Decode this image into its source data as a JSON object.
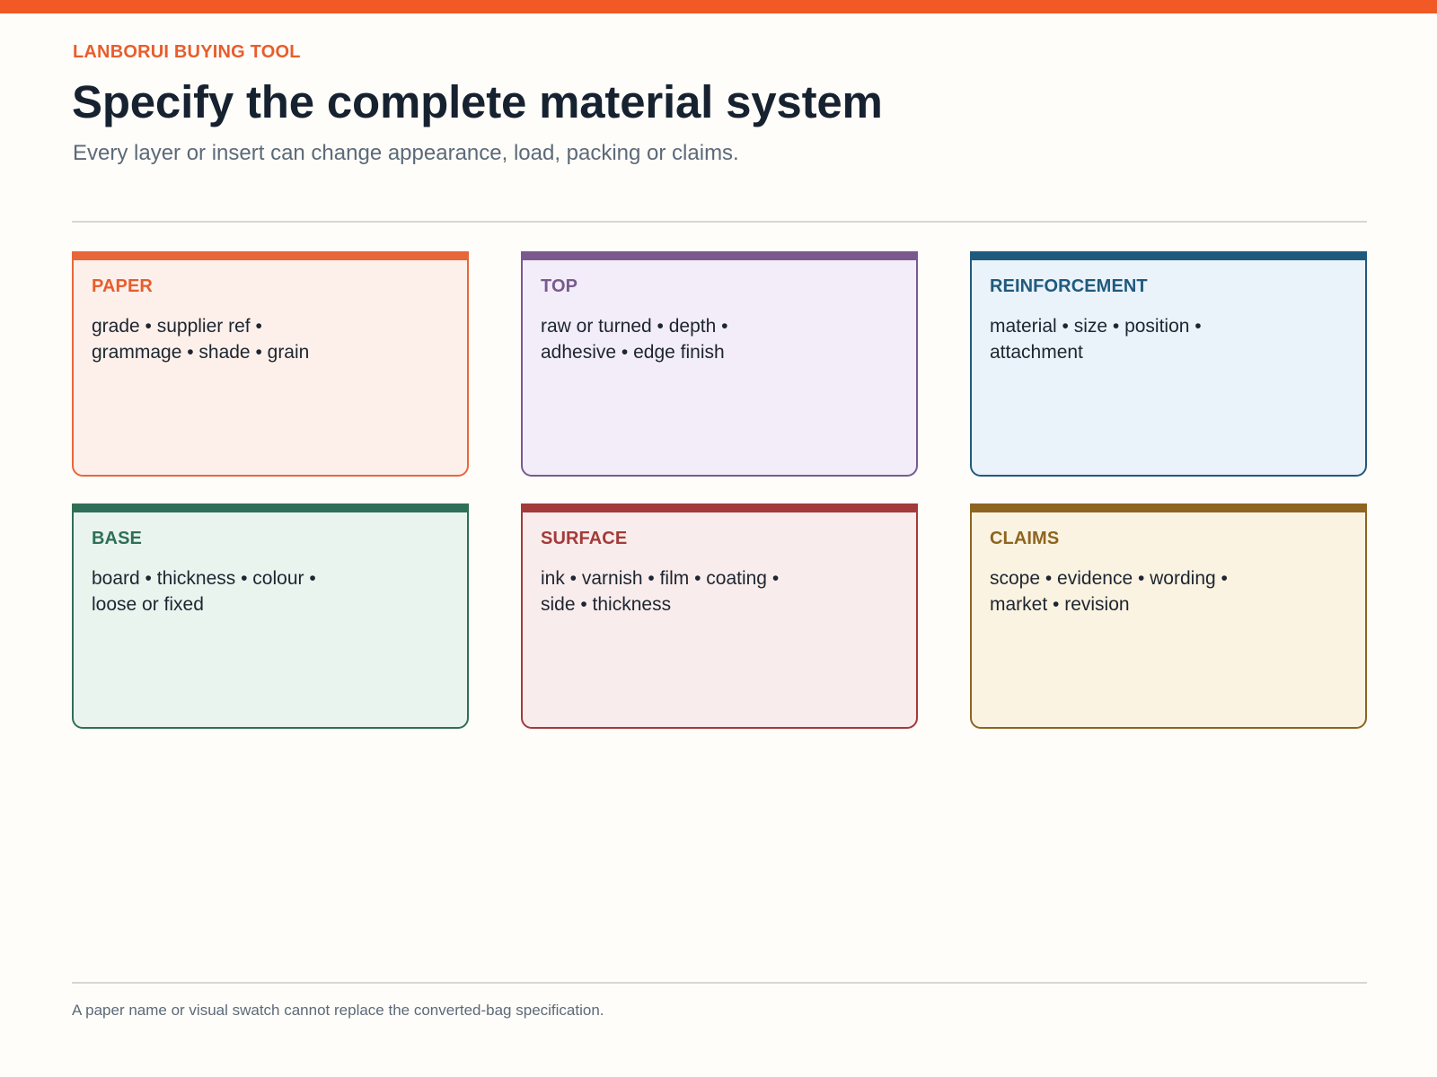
{
  "header": {
    "eyebrow": "LANBORUI BUYING TOOL",
    "title": "Specify the complete material system",
    "subtitle": "Every layer or insert can change appearance, load, packing or claims."
  },
  "colors": {
    "accent": "#f15a24",
    "paper": "#e85d2c",
    "top": "#7a5a8e",
    "reinforcement": "#1f5a7e",
    "base": "#2f6f57",
    "surface": "#a23b3a",
    "claims": "#8d6520"
  },
  "cards": [
    {
      "key": "paper",
      "title": "PAPER",
      "body": "grade • supplier ref • grammage • shade • grain"
    },
    {
      "key": "top",
      "title": "TOP",
      "body": "raw or turned • depth • adhesive • edge finish"
    },
    {
      "key": "reinforcement",
      "title": "REINFORCEMENT",
      "body": "material • size • position • attachment"
    },
    {
      "key": "base",
      "title": "BASE",
      "body": "board • thickness • colour • loose or fixed"
    },
    {
      "key": "surface",
      "title": "SURFACE",
      "body": "ink • varnish • film • coating • side • thickness"
    },
    {
      "key": "claims",
      "title": "CLAIMS",
      "body": "scope • evidence • wording • market • revision"
    }
  ],
  "footer": {
    "note": "A paper name or visual swatch cannot replace the converted-bag specification."
  }
}
